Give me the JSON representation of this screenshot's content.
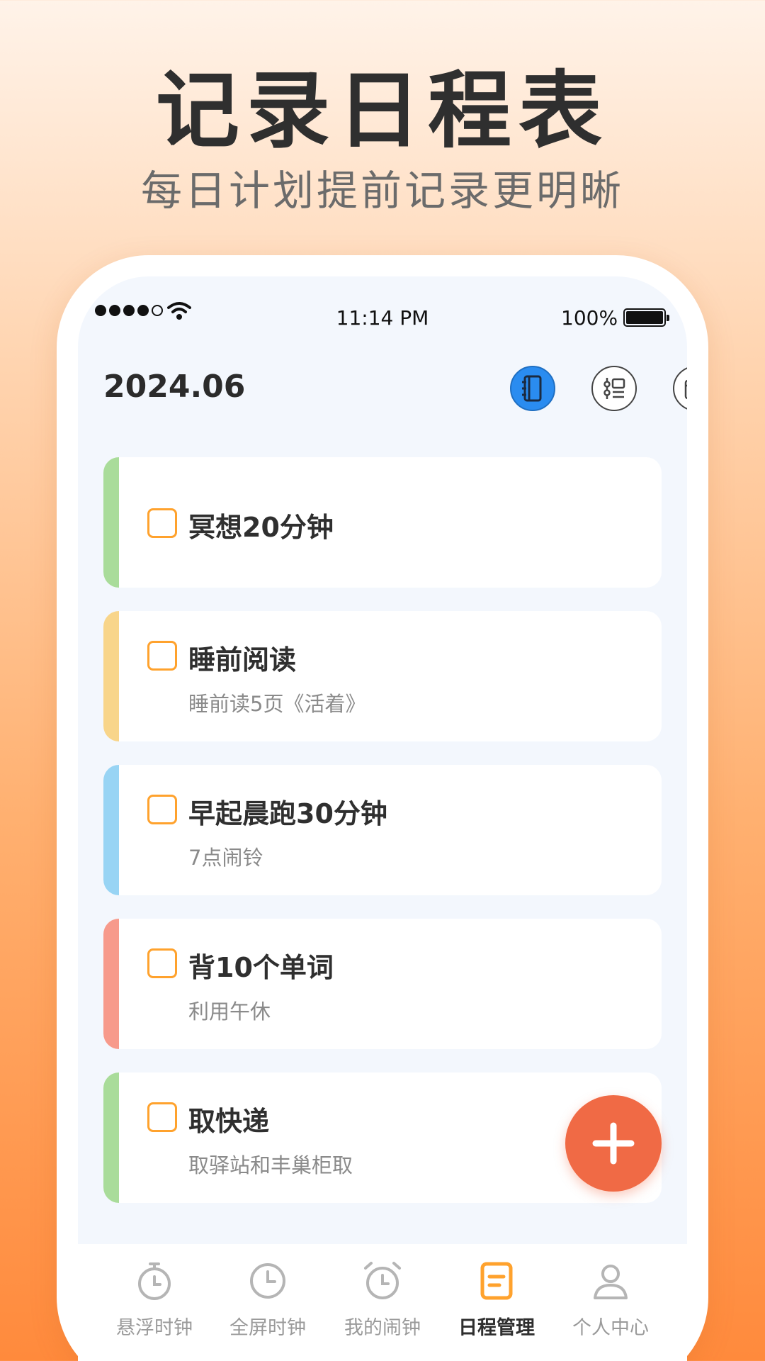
{
  "hero": {
    "title": "记录日程表",
    "subtitle": "每日计划提前记录更明晰"
  },
  "status_bar": {
    "time": "11:14 PM",
    "battery": "100%"
  },
  "header": {
    "date": "2024.06",
    "icons": [
      "notebook-icon",
      "list-settings-icon",
      "calendar-icon"
    ]
  },
  "tasks": [
    {
      "title": "冥想20分钟",
      "note": "",
      "color": "#a9dc9a"
    },
    {
      "title": "睡前阅读",
      "note": "睡前读5页《活着》",
      "color": "#f8d58a"
    },
    {
      "title": "早起晨跑30分钟",
      "note": "7点闹铃",
      "color": "#98d4f4"
    },
    {
      "title": "背10个单词",
      "note": "利用午休",
      "color": "#f79a8b"
    },
    {
      "title": "取快递",
      "note": "取驿站和丰巢柜取",
      "color": "#a9dc9a"
    }
  ],
  "fab": {
    "icon": "plus-icon",
    "color": "#f06a45"
  },
  "tabs": [
    {
      "label": "悬浮时钟",
      "icon": "stopwatch-icon",
      "active": false
    },
    {
      "label": "全屏时钟",
      "icon": "clock-icon",
      "active": false
    },
    {
      "label": "我的闹钟",
      "icon": "alarm-icon",
      "active": false
    },
    {
      "label": "日程管理",
      "icon": "schedule-icon",
      "active": true
    },
    {
      "label": "个人中心",
      "icon": "user-icon",
      "active": false
    }
  ],
  "colors": {
    "accent_orange": "#ffa22d",
    "active_blue": "#2a8cf0"
  }
}
